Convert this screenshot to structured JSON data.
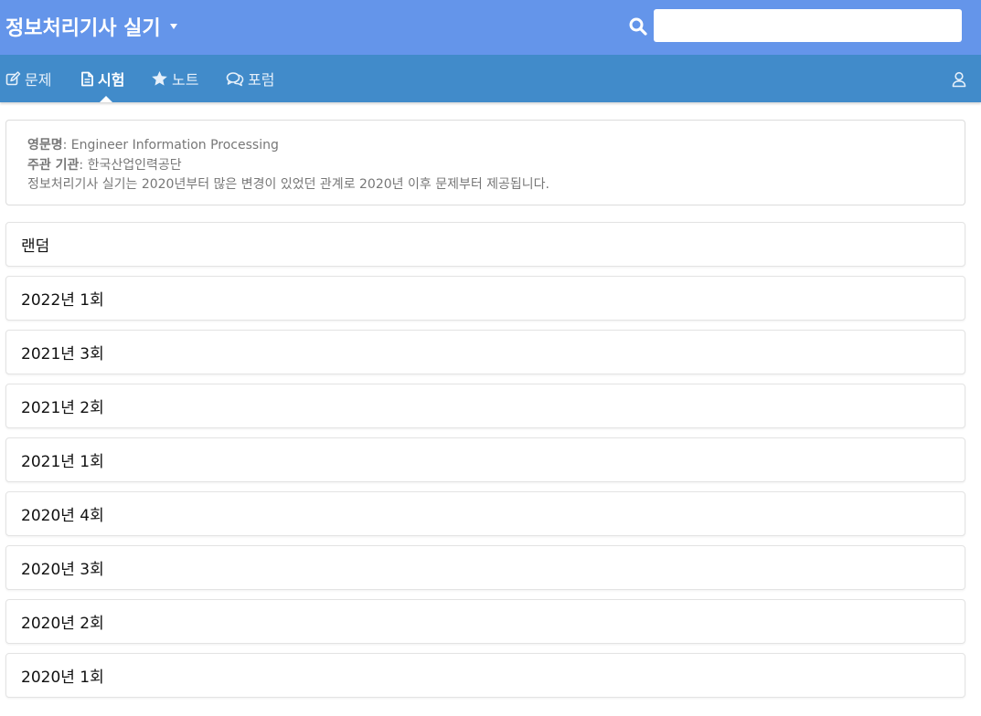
{
  "header": {
    "title": "정보처리기사 실기",
    "title_dropdown_icon": "caret-down-icon",
    "search_icon": "search-icon",
    "search_value": "",
    "bg_color": "#6495ea"
  },
  "nav": {
    "bg_color": "#418bca",
    "items": [
      {
        "label": "문제",
        "icon": "edit-icon",
        "active": false
      },
      {
        "label": "시험",
        "icon": "document-icon",
        "active": true
      },
      {
        "label": "노트",
        "icon": "star-icon",
        "active": false
      },
      {
        "label": "포럼",
        "icon": "chat-bubbles-icon",
        "active": false
      }
    ],
    "user_icon": "user-icon"
  },
  "info": {
    "english_name_label": "영문명",
    "english_name": ": Engineer Information Processing",
    "organizer_label": "주관 기관",
    "organizer": ": 한국산업인력공단",
    "notice": "정보처리기사 실기는 2020년부터 많은 변경이 있었던 관계로 2020년 이후 문제부터 제공됩니다."
  },
  "exams": [
    "랜덤",
    "2022년 1회",
    "2021년 3회",
    "2021년 2회",
    "2021년 1회",
    "2020년 4회",
    "2020년 3회",
    "2020년 2회",
    "2020년 1회"
  ]
}
